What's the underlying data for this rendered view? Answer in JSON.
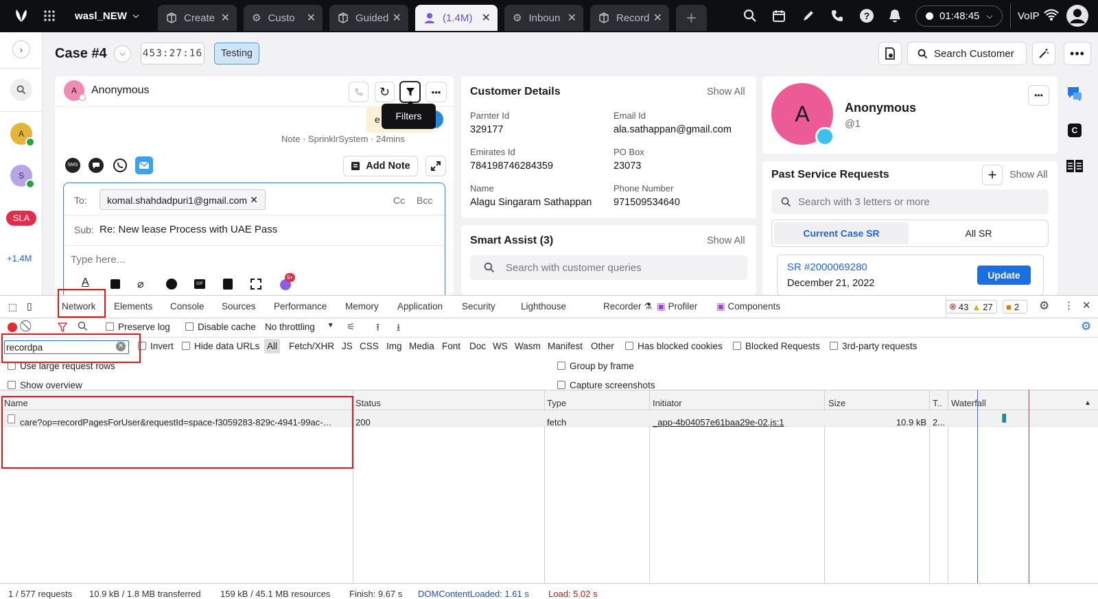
{
  "topbar": {
    "workspace": "wasl_NEW",
    "tabs": [
      {
        "label": "Create"
      },
      {
        "label": "Custo"
      },
      {
        "label": "Guided"
      },
      {
        "label": "(1.4M)"
      },
      {
        "label": "Inboun"
      },
      {
        "label": "Record"
      }
    ],
    "timer": "01:48:45",
    "voip": "VoIP"
  },
  "left_rail": {
    "sla": "SLA",
    "count": "+1.4M",
    "avatar_a": "A",
    "avatar_s": "S"
  },
  "case": {
    "title": "Case #4",
    "timer": "453:27:16",
    "status": "Testing",
    "search_customer": "Search Customer"
  },
  "conversation": {
    "name": "Anonymous",
    "avatar": "A",
    "tooltip": "Filters",
    "bubble_text": "e",
    "note_meta": "Note · SprinklrSystem · 24mins",
    "add_note": "Add Note",
    "to_label": "To:",
    "to_value": "komal.shahdadpuri1@gmail.com",
    "cc": "Cc",
    "bcc": "Bcc",
    "sub_label": "Sub:",
    "subject": "Re: New lease Process with UAE Pass",
    "body_placeholder": "Type here...",
    "badge": "9+"
  },
  "customer_details": {
    "title": "Customer Details",
    "show_all": "Show All",
    "fields": [
      {
        "label": "Parnter Id",
        "value": "329177"
      },
      {
        "label": "Email Id",
        "value": "ala.sathappan@gmail.com"
      },
      {
        "label": "Emirates Id",
        "value": "784198746284359"
      },
      {
        "label": "PO Box",
        "value": "23073"
      },
      {
        "label": "Name",
        "value": "Alagu Singaram Sathappan"
      },
      {
        "label": "Phone Number",
        "value": "971509534640"
      }
    ]
  },
  "smart_assist": {
    "title": "Smart Assist (3)",
    "show_all": "Show All",
    "placeholder": "Search with customer queries"
  },
  "profile": {
    "avatar": "A",
    "name": "Anonymous",
    "handle": "@1"
  },
  "past_sr": {
    "title": "Past Service Requests",
    "show_all": "Show All",
    "placeholder": "Search with 3 letters or more",
    "tab_current": "Current Case SR",
    "tab_all": "All SR",
    "sr_id": "SR #2000069280",
    "sr_date": "December 21, 2022",
    "update": "Update"
  },
  "devtools": {
    "tabs": [
      "Network",
      "Elements",
      "Console",
      "Sources",
      "Performance",
      "Memory",
      "Application",
      "Security",
      "Lighthouse",
      "Recorder",
      "Profiler",
      "Components"
    ],
    "errors": "43",
    "warnings": "27",
    "issues": "2",
    "preserve_log": "Preserve log",
    "disable_cache": "Disable cache",
    "throttling": "No throttling",
    "filter_value": "recordpa",
    "invert": "Invert",
    "hide_data_urls": "Hide data URLs",
    "types": [
      "All",
      "Fetch/XHR",
      "JS",
      "CSS",
      "Img",
      "Media",
      "Font",
      "Doc",
      "WS",
      "Wasm",
      "Manifest",
      "Other"
    ],
    "has_blocked_cookies": "Has blocked cookies",
    "blocked_requests": "Blocked Requests",
    "third_party": "3rd-party requests",
    "large_rows": "Use large request rows",
    "group_by_frame": "Group by frame",
    "show_overview": "Show overview",
    "capture_screenshots": "Capture screenshots",
    "columns": [
      "Name",
      "Status",
      "Type",
      "Initiator",
      "Size",
      "T..",
      "Waterfall"
    ],
    "rows": [
      {
        "name": "care?op=recordPagesForUser&requestId=space-f3059283-829c-4941-99ac-…",
        "status": "200",
        "type": "fetch",
        "initiator": "_app-4b04057e61baa29e-02.js:1",
        "size": "10.9 kB",
        "time": "2..."
      }
    ],
    "status": {
      "requests": "1 / 577 requests",
      "transferred": "10.9 kB / 1.8 MB transferred",
      "resources": "159 kB / 45.1 MB resources",
      "finish": "Finish: 9.67 s",
      "dcl": "DOMContentLoaded: 1.61 s",
      "load": "Load: 5.02 s"
    }
  }
}
